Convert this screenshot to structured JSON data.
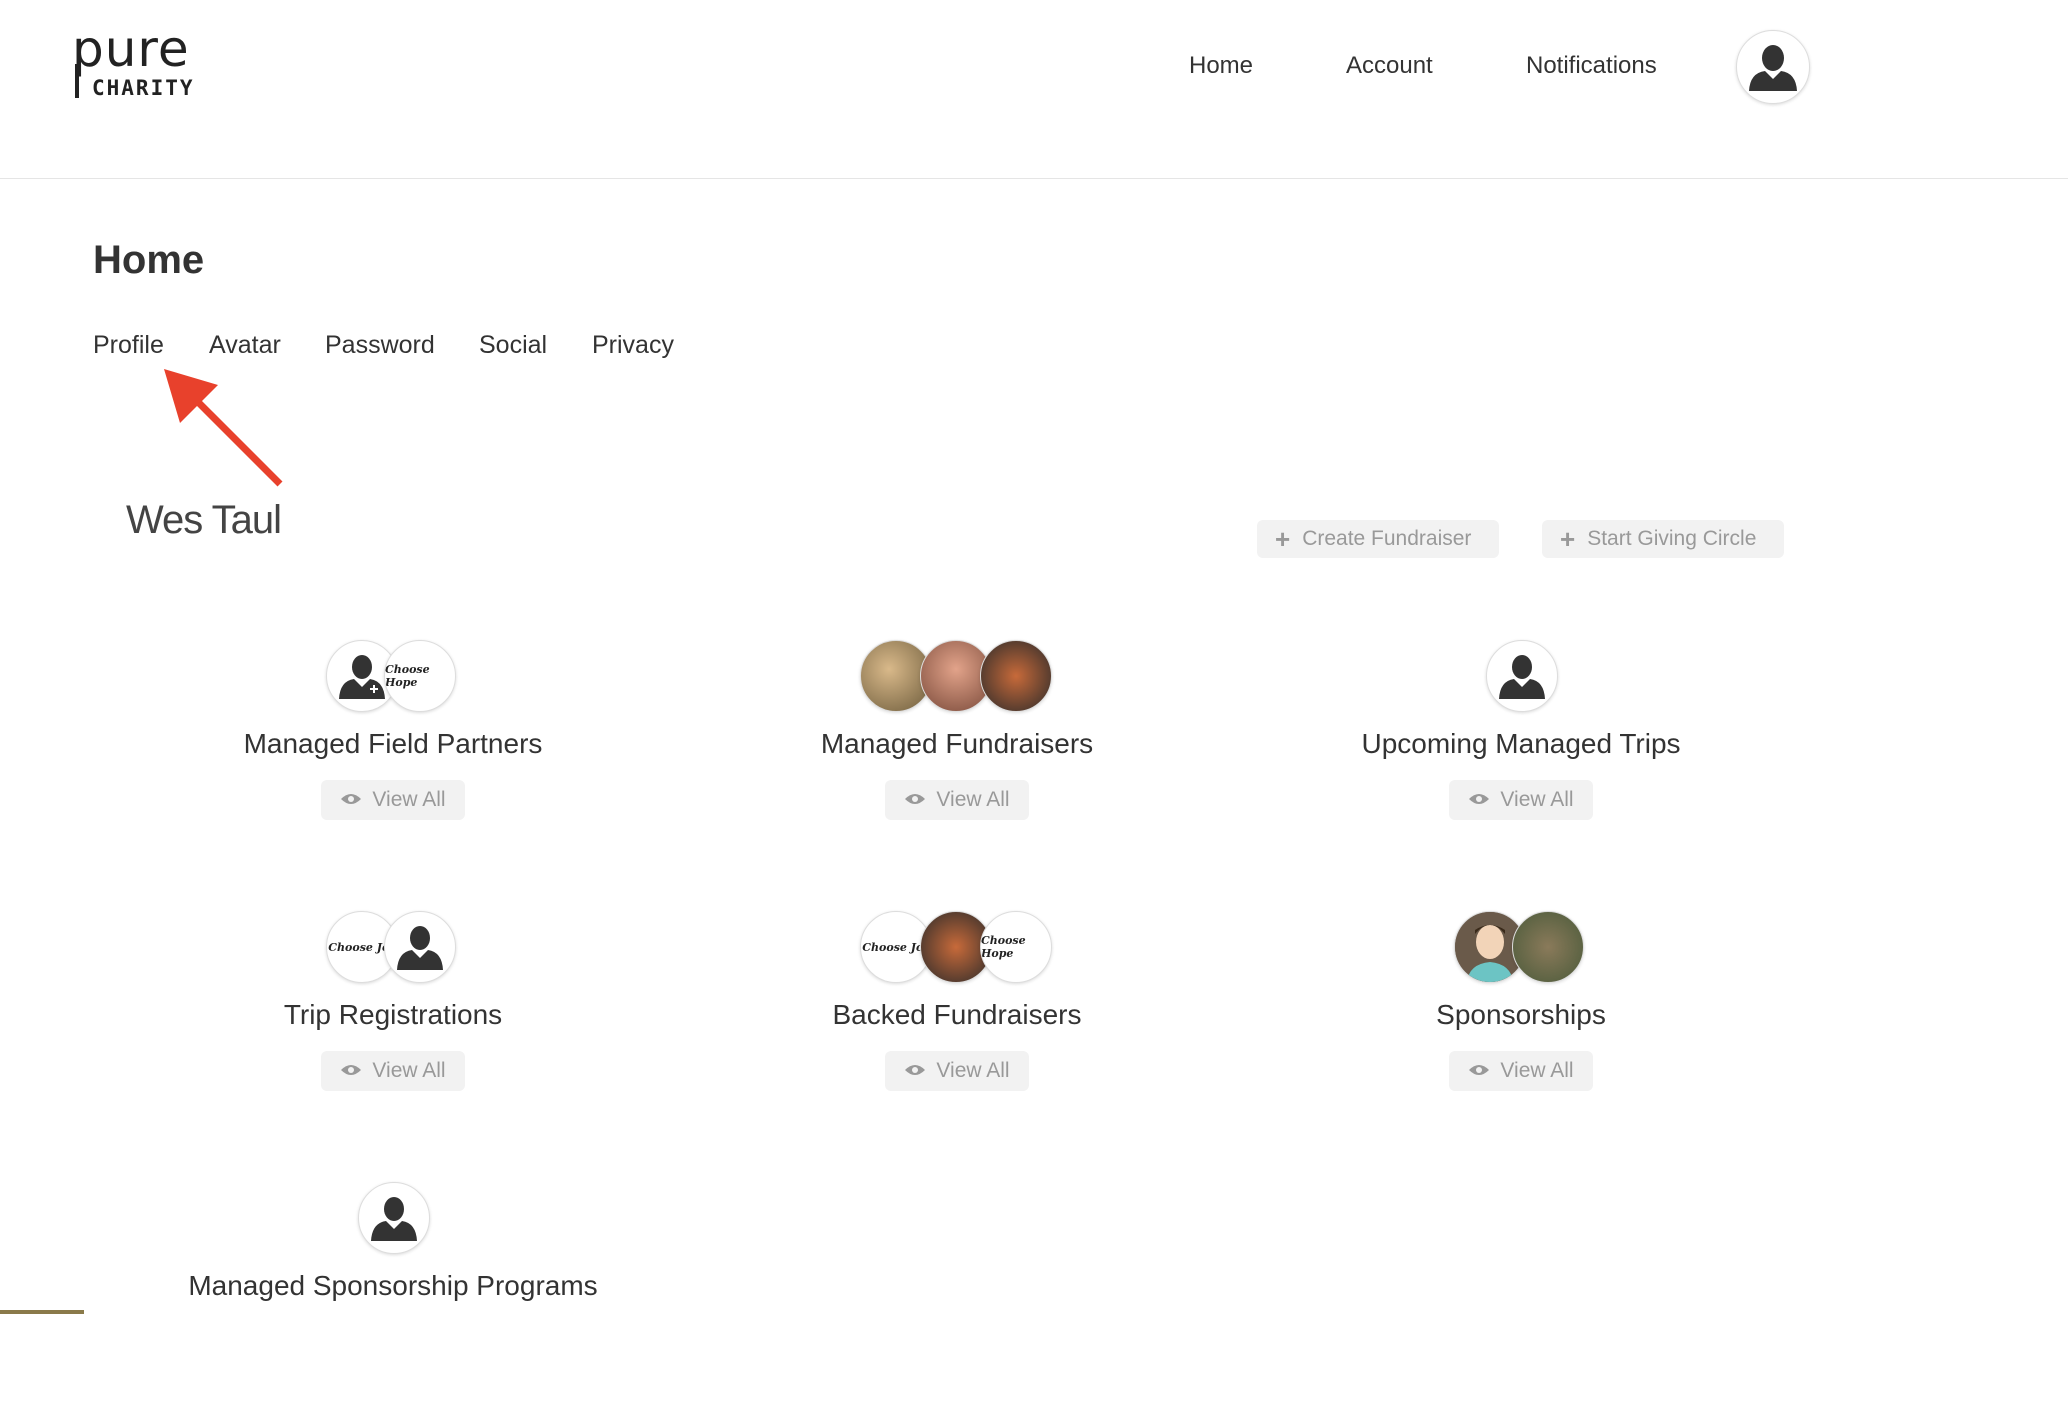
{
  "logo": {
    "word": "pure",
    "sub": "CHARITY"
  },
  "nav": {
    "items": [
      {
        "label": "Home"
      },
      {
        "label": "Account"
      },
      {
        "label": "Notifications"
      }
    ]
  },
  "page": {
    "title": "Home"
  },
  "subtabs": [
    {
      "label": "Profile"
    },
    {
      "label": "Avatar"
    },
    {
      "label": "Password"
    },
    {
      "label": "Social"
    },
    {
      "label": "Privacy"
    }
  ],
  "user": {
    "name": "Wes Taul"
  },
  "actions": {
    "create_fundraiser": "Create Fundraiser",
    "start_giving_circle": "Start Giving Circle"
  },
  "cards": [
    {
      "title": "Managed Field Partners",
      "view_all": "View All",
      "avatars": [
        "person-icon",
        "choose-hope-logo"
      ]
    },
    {
      "title": "Managed Fundraisers",
      "view_all": "View All",
      "avatars": [
        "photo",
        "photo",
        "photo"
      ]
    },
    {
      "title": "Upcoming Managed Trips",
      "view_all": "View All",
      "avatars": [
        "person-icon"
      ]
    },
    {
      "title": "Trip Registrations",
      "view_all": "View All",
      "avatars": [
        "choose-joy-logo",
        "person-icon"
      ]
    },
    {
      "title": "Backed Fundraisers",
      "view_all": "View All",
      "avatars": [
        "choose-joy-logo",
        "photo",
        "choose-hope-logo"
      ]
    },
    {
      "title": "Sponsorships",
      "view_all": "View All",
      "avatars": [
        "face-avatar",
        "photo"
      ]
    },
    {
      "title": "Managed Sponsorship Programs",
      "avatars": [
        "person-icon"
      ]
    }
  ],
  "logo_text": {
    "choose_hope": "Choose Hope",
    "choose_joy": "Choose Joy"
  },
  "colors": {
    "accent_arrow": "#e8412c",
    "text": "#333333",
    "muted": "#999999",
    "button_bg": "#f2f2f2"
  }
}
